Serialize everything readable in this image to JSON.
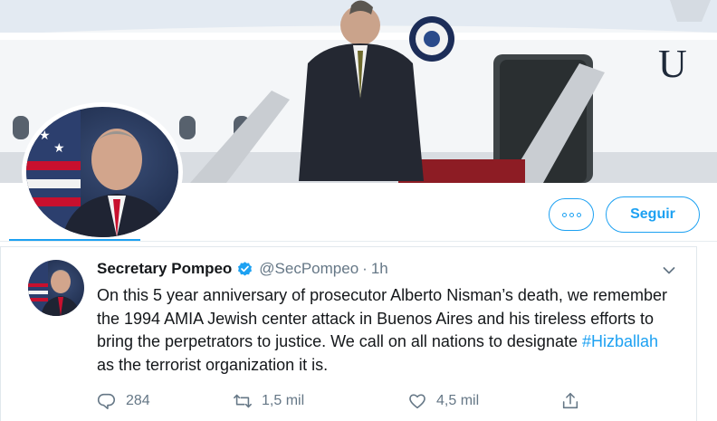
{
  "profile": {
    "follow_label": "Seguir"
  },
  "tweet": {
    "display_name": "Secretary Pompeo",
    "handle": "@SecPompeo",
    "separator": "·",
    "time": "1h",
    "text_before": "On this 5 year anniversary of prosecutor Alberto Nisman’s death, we remember the 1994 AMIA Jewish center attack in Buenos Aires and his tireless efforts to bring the perpetrators to justice. We call on all nations to designate ",
    "hashtag": "#Hizballah",
    "text_after": " as the terrorist organization it is.",
    "replies": "284",
    "retweets": "1,5 mil",
    "likes": "4,5 mil"
  },
  "icons": {
    "more": "more-dots-icon",
    "verified": "verified-badge-icon",
    "caret": "chevron-down-icon",
    "reply": "reply-icon",
    "retweet": "retweet-icon",
    "like": "heart-icon",
    "share": "share-icon"
  },
  "colors": {
    "accent": "#1da1f2",
    "text": "#14171a",
    "muted": "#657786",
    "border": "#e1e8ed"
  }
}
